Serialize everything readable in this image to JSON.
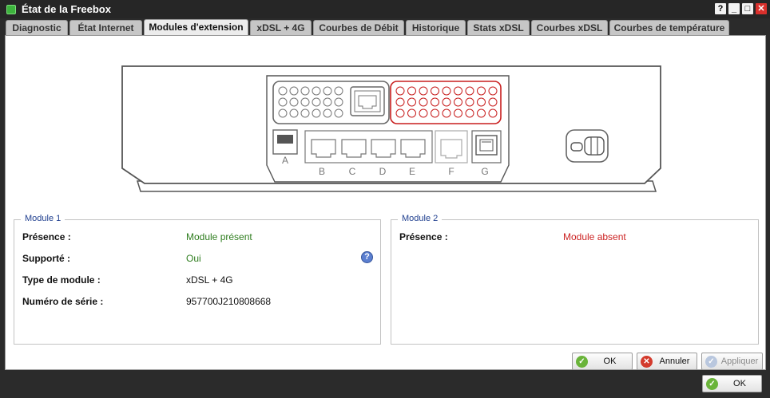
{
  "window": {
    "title": "État de la Freebox",
    "buttons": [
      "?",
      "_",
      "□",
      "✕"
    ]
  },
  "tabs": [
    {
      "label": "Diagnostic",
      "active": false
    },
    {
      "label": "État Internet",
      "active": false
    },
    {
      "label": "Modules d'extension",
      "active": true
    },
    {
      "label": "xDSL + 4G",
      "active": false
    },
    {
      "label": "Courbes de Débit",
      "active": false
    },
    {
      "label": "Historique",
      "active": false
    },
    {
      "label": "Stats xDSL",
      "active": false
    },
    {
      "label": "Courbes xDSL",
      "active": false
    },
    {
      "label": "Courbes de température",
      "active": false
    }
  ],
  "device": {
    "port_labels": [
      "A",
      "B",
      "C",
      "D",
      "E",
      "F",
      "G"
    ],
    "module2_highlight_color": "#c81e1e"
  },
  "module1": {
    "legend": "Module 1",
    "rows": [
      {
        "label": "Présence :",
        "value": "Module présent",
        "status": "ok"
      },
      {
        "label": "Supporté :",
        "value": "Oui",
        "status": "ok"
      },
      {
        "label": "Type de module :",
        "value": "xDSL + 4G",
        "status": "plain"
      },
      {
        "label": "Numéro de série :",
        "value": "957700J210808668",
        "status": "plain"
      }
    ],
    "help_icon": "?"
  },
  "module2": {
    "legend": "Module 2",
    "rows": [
      {
        "label": "Présence :",
        "value": "Module absent",
        "status": "err"
      }
    ]
  },
  "footer": {
    "ok": "OK",
    "cancel": "Annuler",
    "apply": "Appliquer",
    "outer_ok": "OK"
  },
  "colors": {
    "ok_text": "#2e7d1e",
    "err_text": "#cc2222",
    "legend_text": "#1f3f8f"
  }
}
